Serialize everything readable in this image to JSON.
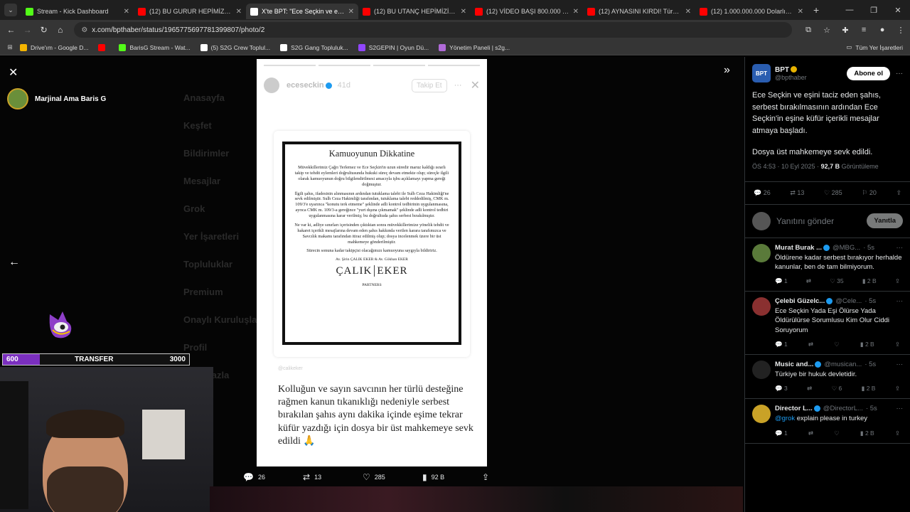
{
  "browser": {
    "tabs": [
      {
        "title": "Stream - Kick Dashboard",
        "color": "#53fc18",
        "active": false
      },
      {
        "title": "(12) BU GURUR HEPİMİZİN | M",
        "color": "#ff0000",
        "active": false
      },
      {
        "title": "X'te BPT: \"Ece Seçkin ve eşini ta",
        "color": "#ffffff",
        "active": true
      },
      {
        "title": "(12) BU UTANÇ HEPİMİZİN | M",
        "color": "#ff0000",
        "active": false
      },
      {
        "title": "(12) VİDEO BAŞI 800.000 TL DU",
        "color": "#ff0000",
        "active": false
      },
      {
        "title": "(12) AYNASINI KIRDI! Türkiye'd",
        "color": "#ff0000",
        "active": false
      },
      {
        "title": "(12) 1.000.000.000 Dolarlık Çi",
        "color": "#ff0000",
        "active": false
      }
    ],
    "url": "x.com/bpthaber/status/1965775697781399807/photo/2",
    "bookmarks": [
      {
        "label": "Drive'ım - Google D...",
        "color": "#f4b400"
      },
      {
        "label": "",
        "color": "#ff0000"
      },
      {
        "label": "BarisG Stream - Wat...",
        "color": "#53fc18"
      },
      {
        "label": "(5) S2G Crew Toplul...",
        "color": "#ffffff"
      },
      {
        "label": "S2G Gang Topluluk...",
        "color": "#ffffff"
      },
      {
        "label": "S2GEPIN | Oyun Dü...",
        "color": "#9146ff"
      },
      {
        "label": "Yönetim Paneli | s2g...",
        "color": "#b06ad8"
      }
    ],
    "all_bookmarks": "Tüm Yer İşaretleri"
  },
  "overlay": {
    "streamer_name": "Marjinal Ama Baris G",
    "transfer": {
      "left": "600",
      "label": "TRANSFER",
      "right": "3000",
      "progress": 0.2
    }
  },
  "background_nav": [
    "Anasayfa",
    "Keşfet",
    "Bildirimler",
    "Mesajlar",
    "Grok",
    "Yer İşaretleri",
    "Topluluklar",
    "Premium",
    "Onaylı Kuruluşlar",
    "Profil",
    "Daha fazla"
  ],
  "story": {
    "username": "eceseckin",
    "time": "41d",
    "follow": "Takip Et",
    "notice_title": "Kamuoyunun Dikkatine",
    "notice_p1": "Müvekkillerimiz Çağrı Terlemez ve Ece Seçkin'in uzun süredir maruz kaldığı ısrarlı takip ve tehdit eylemleri doğrultusunda hukuki süreç devam etmekte olup; süreçle ilgili olarak kamuoyunun doğru bilgilendirilmesi amacıyla işbu açıklamayı yapma gereği doğmuştur.",
    "notice_p2": "İlgili şahıs, ifadesinin alınmasının ardından tutuklama talebi ile Sulh Ceza Hakimliği'ne sevk edilmiştir. Sulh Ceza Hakimliği tarafından, tutuklama talebi reddedilmiş, CMK m. 109/3'e uyarınca \"konutu terk etmeme\" şeklinde adli kontrol tedbirinin uygulanmasına, ayrıca CMK m. 109/3-a gereğince \"yurt dışına çıkmamak\" şeklinde adli kontrol tedbiri uygulanmasına karar verilmiş; bu doğrultuda şahıs serbest bırakılmıştır.",
    "notice_p3": "Ne var ki, adliye sınırları içerisinden çıktıktan sonra müvekkillerimize yönelik tehdit ve hakaret içerikli mesajlarına devam eden şahıs hakkında verilen karara tarafımızca ve Savcılık makamı tarafından itiraz edilmiş olup; dosya incelenmek üzere bir üst mahkemeye gönderilmiştir.",
    "notice_p4": "Sürecin sonuna kadar takipçisi olacağımızı kamuoyuna saygıyla bildiririz.",
    "notice_sig": "Av. Şirin ÇALIK EKER & Av. Gökhan EKER",
    "firm_a": "ÇALIK",
    "firm_b": "EKER",
    "partners": "PARTNERS",
    "tagline": "@calikeker",
    "caption": "Kolluğun ve sayın savcının her türlü desteğine rağmen kanun tıkanıklığı nedeniyle serbest bırakılan şahıs aynı dakika içinde eşime tekrar küfür yazdığı için dosya bir üst mahkemeye sevk edildi 🙏"
  },
  "story_actions": {
    "replies": "26",
    "reposts": "13",
    "likes": "285",
    "views": "92 B"
  },
  "tweet": {
    "author": "BPT",
    "handle": "@bpthaber",
    "logo_text": "BPT",
    "subscribe": "Abone ol",
    "text1": "Ece Seçkin ve eşini taciz eden şahıs, serbest bırakılmasının ardından Ece Seçkin'in eşine küfür içerikli mesajlar atmaya başladı.",
    "text2": "Dosya üst mahkemeye sevk edildi.",
    "time": "ÖS 4:53 · 10 Eyl 2025 · ",
    "views": "92,7 B",
    "views_label": " Görüntüleme",
    "replies": "26",
    "reposts": "13",
    "likes": "285",
    "bookmarks": "20",
    "reply_placeholder": "Yanıtını gönder",
    "reply_button": "Yanıtla"
  },
  "replies": [
    {
      "name": "Murat Burak ...",
      "handle": "@MBG...",
      "time": "· 5s",
      "text": "Öldürene kadar serbest bırakıyor herhalde kanunlar, ben de tam bilmiyorum.",
      "mention": "",
      "r": "1",
      "rt": "",
      "l": "35",
      "v": "2 B",
      "color": "#5a7a3a"
    },
    {
      "name": "Çelebi Güzelc...",
      "handle": "@Cele...",
      "time": "· 5s",
      "text": "Ece Seçkin Yada Eşi Ölürse Yada Öldürülürse Sorumlusu Kim Olur Ciddi Soruyorum",
      "mention": "",
      "r": "1",
      "rt": "",
      "l": "",
      "v": "2 B",
      "color": "#8a3030"
    },
    {
      "name": "Music and...",
      "handle": "@musican...",
      "time": "· 5s",
      "text": "Türkiye bir hukuk devletidir.",
      "mention": "",
      "r": "3",
      "rt": "",
      "l": "6",
      "v": "2 B",
      "color": "#222222"
    },
    {
      "name": "Director L...",
      "handle": "@DirectorL...",
      "time": "· 5s",
      "text": " explain please in turkey",
      "mention": "@grok",
      "r": "1",
      "rt": "",
      "l": "",
      "v": "2 B",
      "color": "#c9a227"
    }
  ]
}
